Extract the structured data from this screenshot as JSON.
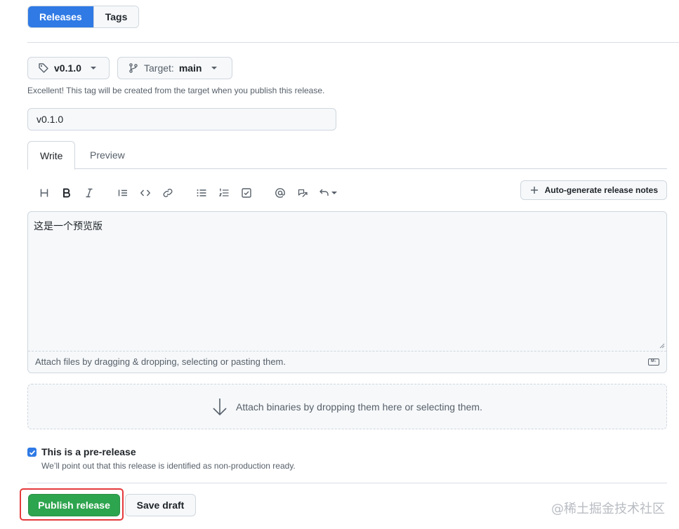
{
  "nav": {
    "releases_tab": "Releases",
    "tags_tab": "Tags"
  },
  "tag_picker": {
    "value": "v0.1.0"
  },
  "target_picker": {
    "label": "Target:",
    "value": "main"
  },
  "tag_hint": "Excellent! This tag will be created from the target when you publish this release.",
  "title_field": {
    "value": "v0.1.0"
  },
  "editor_tabs": {
    "write": "Write",
    "preview": "Preview"
  },
  "auto_generate_label": "Auto-generate release notes",
  "toolbar_icons": [
    "heading-icon",
    "bold-icon",
    "italic-icon",
    "quote-icon",
    "code-icon",
    "link-icon",
    "bulleted-list-icon",
    "numbered-list-icon",
    "task-list-icon",
    "mention-icon",
    "reference-icon",
    "undo-icon"
  ],
  "editor": {
    "body": "这是一个预览版",
    "attach_hint": "Attach files by dragging & dropping, selecting or pasting them.",
    "markdown_badge": "M↓"
  },
  "binaries_hint": "Attach binaries by dropping them here or selecting them.",
  "prerelease": {
    "checked": true,
    "label": "This is a pre-release",
    "description": "We’ll point out that this release is identified as non-production ready."
  },
  "actions": {
    "publish": "Publish release",
    "save_draft": "Save draft"
  },
  "watermark": "@稀土掘金技术社区",
  "colors": {
    "accent_blue": "#2f7ae5",
    "publish_green": "#2da44e",
    "highlight_red": "#e5393b"
  }
}
